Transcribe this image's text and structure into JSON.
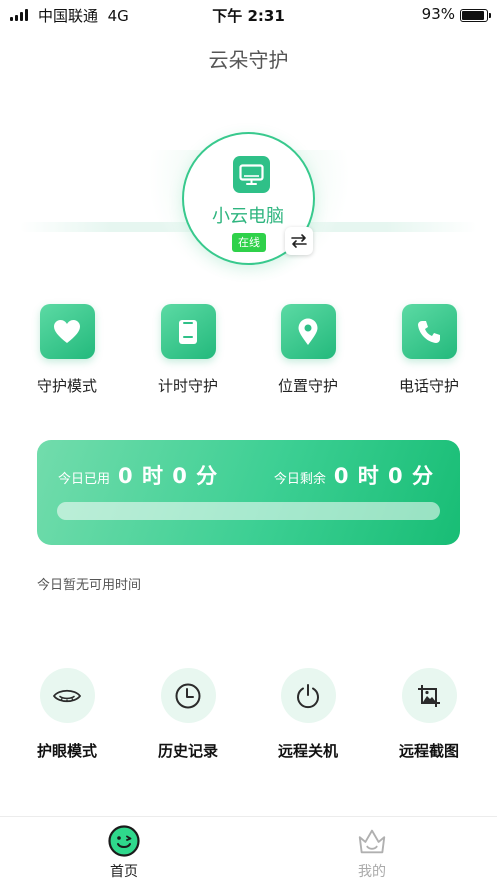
{
  "status_bar": {
    "carrier": "中国联通",
    "network": "4G",
    "time": "下午 2:31",
    "battery_pct": "93%",
    "battery_level": 0.93
  },
  "header": {
    "title": "云朵守护"
  },
  "device": {
    "name": "小云电脑",
    "status": "在线",
    "icon": "monitor-icon",
    "switch_icon": "swap-icon"
  },
  "features": [
    {
      "label": "守护模式",
      "icon": "heart-icon"
    },
    {
      "label": "计时守护",
      "icon": "phone-timer-icon"
    },
    {
      "label": "位置守护",
      "icon": "location-pin-icon"
    },
    {
      "label": "电话守护",
      "icon": "phone-call-icon"
    }
  ],
  "time_card": {
    "used_label": "今日已用",
    "used_value": "0 时 0 分",
    "remaining_label": "今日剩余",
    "remaining_value": "0 时 0 分",
    "progress": 0
  },
  "notice": "今日暂无可用时间",
  "tools": [
    {
      "label": "护眼模式",
      "icon": "eye-icon"
    },
    {
      "label": "历史记录",
      "icon": "clock-icon"
    },
    {
      "label": "远程关机",
      "icon": "power-icon"
    },
    {
      "label": "远程截图",
      "icon": "screenshot-icon"
    }
  ],
  "tabbar": {
    "home_label": "首页",
    "mine_label": "我的"
  },
  "colors": {
    "accent": "#2fc088",
    "online": "#2fd14a",
    "tab_active": "#222222",
    "tab_inactive": "#aaaaaa"
  }
}
